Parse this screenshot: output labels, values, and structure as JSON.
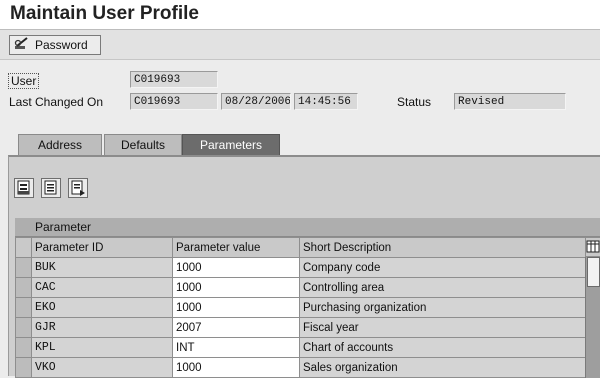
{
  "window": {
    "title": "Maintain User Profile"
  },
  "toolbar": {
    "password_label": "Password"
  },
  "header": {
    "user_label": "User",
    "user_value": "C019693",
    "last_changed_label": "Last Changed On",
    "changed_by": "C019693",
    "changed_date": "08/28/2006",
    "changed_time": "14:45:56",
    "status_label": "Status",
    "status_value": "Revised"
  },
  "tabs": [
    {
      "label": "Address"
    },
    {
      "label": "Defaults"
    },
    {
      "label": "Parameters"
    }
  ],
  "active_tab": "Parameters",
  "table": {
    "title": "Parameter",
    "columns": [
      "Parameter ID",
      "Parameter value",
      "Short Description"
    ],
    "rows": [
      {
        "id": "BUK",
        "value": "1000",
        "desc": "Company code"
      },
      {
        "id": "CAC",
        "value": "1000",
        "desc": "Controlling area"
      },
      {
        "id": "EKO",
        "value": "1000",
        "desc": "Purchasing organization"
      },
      {
        "id": "GJR",
        "value": "2007",
        "desc": "Fiscal year"
      },
      {
        "id": "KPL",
        "value": "INT",
        "desc": "Chart of accounts"
      },
      {
        "id": "VKO",
        "value": "1000",
        "desc": "Sales organization"
      }
    ]
  },
  "icons": {
    "password": "key-pen-icon",
    "table_actions": [
      "select-all-icon",
      "deselect-all-icon",
      "details-icon"
    ],
    "column_settings": "column-settings-icon"
  },
  "colors": {
    "active_tab": "#6c6c6c",
    "panel": "#cfcfcf",
    "editable_cell": "#ffffff"
  }
}
